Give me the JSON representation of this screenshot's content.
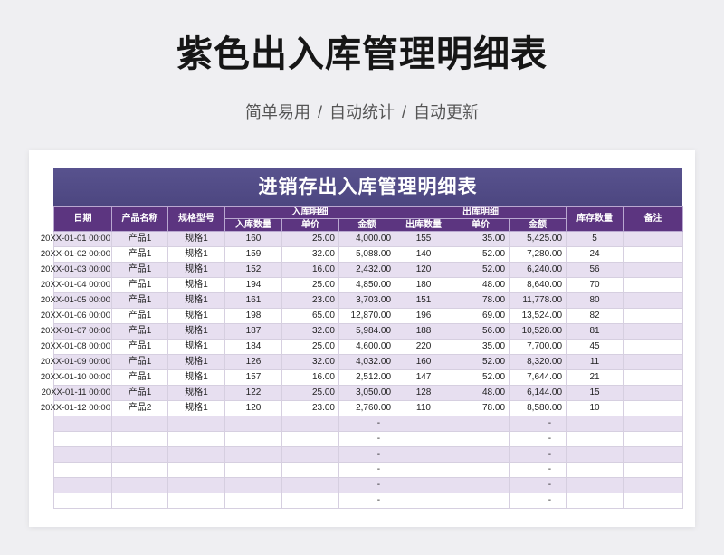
{
  "page": {
    "title": "紫色出入库管理明细表",
    "subtitle": "简单易用 / 自动统计 / 自动更新"
  },
  "colors": {
    "background": "#efeff2",
    "banner": "#4c4680",
    "header": "#5c3580",
    "stripe": "#e7dff0",
    "text": "#1f1f1f",
    "grid": "#d6cfe0"
  },
  "table": {
    "banner_title": "进销存出入库管理明细表",
    "headers": {
      "date": "日期",
      "product": "产品名称",
      "spec": "规格型号",
      "in_group": "入库明细",
      "out_group": "出库明细",
      "stock": "库存数量",
      "remark": "备注",
      "in_qty": "入库数量",
      "in_price": "单价",
      "in_amount": "金额",
      "out_qty": "出库数量",
      "out_price": "单价",
      "out_amount": "金额"
    },
    "rows": [
      {
        "date": "20XX-01-01 00:00",
        "product": "产品1",
        "spec": "规格1",
        "in_qty": "160",
        "in_price": "25.00",
        "in_amount": "4,000.00",
        "out_qty": "155",
        "out_price": "35.00",
        "out_amount": "5,425.00",
        "stock": "5"
      },
      {
        "date": "20XX-01-02 00:00",
        "product": "产品1",
        "spec": "规格1",
        "in_qty": "159",
        "in_price": "32.00",
        "in_amount": "5,088.00",
        "out_qty": "140",
        "out_price": "52.00",
        "out_amount": "7,280.00",
        "stock": "24"
      },
      {
        "date": "20XX-01-03 00:00",
        "product": "产品1",
        "spec": "规格1",
        "in_qty": "152",
        "in_price": "16.00",
        "in_amount": "2,432.00",
        "out_qty": "120",
        "out_price": "52.00",
        "out_amount": "6,240.00",
        "stock": "56"
      },
      {
        "date": "20XX-01-04 00:00",
        "product": "产品1",
        "spec": "规格1",
        "in_qty": "194",
        "in_price": "25.00",
        "in_amount": "4,850.00",
        "out_qty": "180",
        "out_price": "48.00",
        "out_amount": "8,640.00",
        "stock": "70"
      },
      {
        "date": "20XX-01-05 00:00",
        "product": "产品1",
        "spec": "规格1",
        "in_qty": "161",
        "in_price": "23.00",
        "in_amount": "3,703.00",
        "out_qty": "151",
        "out_price": "78.00",
        "out_amount": "11,778.00",
        "stock": "80"
      },
      {
        "date": "20XX-01-06 00:00",
        "product": "产品1",
        "spec": "规格1",
        "in_qty": "198",
        "in_price": "65.00",
        "in_amount": "12,870.00",
        "out_qty": "196",
        "out_price": "69.00",
        "out_amount": "13,524.00",
        "stock": "82"
      },
      {
        "date": "20XX-01-07 00:00",
        "product": "产品1",
        "spec": "规格1",
        "in_qty": "187",
        "in_price": "32.00",
        "in_amount": "5,984.00",
        "out_qty": "188",
        "out_price": "56.00",
        "out_amount": "10,528.00",
        "stock": "81"
      },
      {
        "date": "20XX-01-08 00:00",
        "product": "产品1",
        "spec": "规格1",
        "in_qty": "184",
        "in_price": "25.00",
        "in_amount": "4,600.00",
        "out_qty": "220",
        "out_price": "35.00",
        "out_amount": "7,700.00",
        "stock": "45"
      },
      {
        "date": "20XX-01-09 00:00",
        "product": "产品1",
        "spec": "规格1",
        "in_qty": "126",
        "in_price": "32.00",
        "in_amount": "4,032.00",
        "out_qty": "160",
        "out_price": "52.00",
        "out_amount": "8,320.00",
        "stock": "11"
      },
      {
        "date": "20XX-01-10 00:00",
        "product": "产品1",
        "spec": "规格1",
        "in_qty": "157",
        "in_price": "16.00",
        "in_amount": "2,512.00",
        "out_qty": "147",
        "out_price": "52.00",
        "out_amount": "7,644.00",
        "stock": "21"
      },
      {
        "date": "20XX-01-11 00:00",
        "product": "产品1",
        "spec": "规格1",
        "in_qty": "122",
        "in_price": "25.00",
        "in_amount": "3,050.00",
        "out_qty": "128",
        "out_price": "48.00",
        "out_amount": "6,144.00",
        "stock": "15"
      },
      {
        "date": "20XX-01-12 00:00",
        "product": "产品2",
        "spec": "规格1",
        "in_qty": "120",
        "in_price": "23.00",
        "in_amount": "2,760.00",
        "out_qty": "110",
        "out_price": "78.00",
        "out_amount": "8,580.00",
        "stock": "10"
      }
    ],
    "blank_rows": [
      {
        "in_amount": "-",
        "out_amount": "-"
      },
      {
        "in_amount": "-",
        "out_amount": "-"
      },
      {
        "in_amount": "-",
        "out_amount": "-"
      },
      {
        "in_amount": "-",
        "out_amount": "-"
      },
      {
        "in_amount": "-",
        "out_amount": "-"
      },
      {
        "in_amount": "-",
        "out_amount": "-"
      }
    ]
  }
}
